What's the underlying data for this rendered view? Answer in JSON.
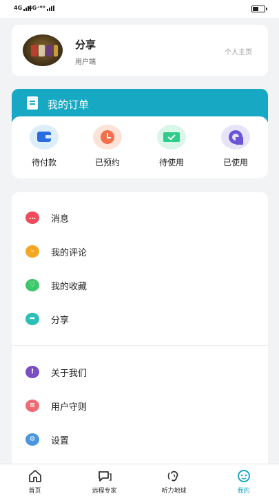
{
  "status_bar": {
    "network_1": "4G",
    "network_2": "4G⁺ᴴᴰ"
  },
  "profile": {
    "username": "分享",
    "user_type": "用户端",
    "homepage_link": "个人主页"
  },
  "orders": {
    "title": "我的订单",
    "items": [
      {
        "label": "待付款",
        "icon": "wallet-icon",
        "bg": "#dceefa",
        "color": "#2a6de0"
      },
      {
        "label": "已预约",
        "icon": "clock-icon",
        "bg": "#fde3d7",
        "color": "#f2704b"
      },
      {
        "label": "待使用",
        "icon": "ticket-icon",
        "bg": "#d9f6e9",
        "color": "#2fcb8b"
      },
      {
        "label": "已使用",
        "icon": "done-icon",
        "bg": "#e7e3f9",
        "color": "#6b54d6"
      }
    ]
  },
  "menu": {
    "items": [
      {
        "label": "消息",
        "icon": "message-icon",
        "color": "#ef4b5b"
      },
      {
        "label": "我的评论",
        "icon": "comment-icon",
        "color": "#f5a623"
      },
      {
        "label": "我的收藏",
        "icon": "heart-icon",
        "color": "#3cc76a"
      },
      {
        "label": "分享",
        "icon": "share-icon",
        "color": "#2bbfb8"
      },
      {
        "label": "关于我们",
        "icon": "info-icon",
        "color": "#7b4fc1"
      },
      {
        "label": "用户守则",
        "icon": "rules-icon",
        "color": "#ef6b73"
      },
      {
        "label": "设置",
        "icon": "settings-icon",
        "color": "#4a97e0"
      }
    ]
  },
  "tabbar": {
    "items": [
      {
        "label": "首页",
        "icon": "home-icon"
      },
      {
        "label": "远程专家",
        "icon": "chat-icon"
      },
      {
        "label": "听力地球",
        "icon": "ear-icon"
      },
      {
        "label": "我的",
        "icon": "profile-icon"
      }
    ],
    "active": "我的",
    "accent_color": "#17a8c3"
  }
}
